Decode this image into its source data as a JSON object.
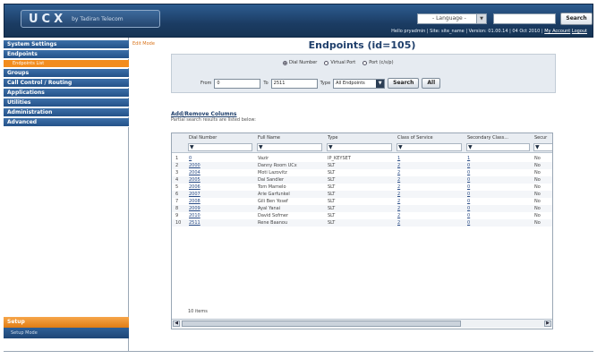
{
  "header": {
    "logo_mark": "UCX",
    "logo_by": "by Tadiran Telecom",
    "language_placeholder": "- Language -",
    "search_button": "Search",
    "status": {
      "greeting": "Hello pryadmin",
      "site": "Site: site_name",
      "version": "Version: 01.00.14",
      "date": "04 Oct 2010",
      "my_account": "My Account",
      "logout": "Logout"
    }
  },
  "sidebar": {
    "items": [
      {
        "label": "System Settings"
      },
      {
        "label": "Endpoints"
      },
      {
        "label": "Groups"
      },
      {
        "label": "Call Control / Routing"
      },
      {
        "label": "Applications"
      },
      {
        "label": "Utilities"
      },
      {
        "label": "Administration"
      },
      {
        "label": "Advanced"
      }
    ],
    "sub_active": "Endpoints List",
    "setup": "Setup",
    "setup_sub": "Setup Mode"
  },
  "main": {
    "breadcrumb": "Edit Mode",
    "title": "Endpoints (id=105)",
    "filter": {
      "radios": [
        "Dial Number",
        "Virtual Port",
        "Port (c/s/p)"
      ],
      "selected_radio": 0,
      "from_label": "From",
      "from_value": "0",
      "to_label": "To",
      "to_value": "2511",
      "type_label": "Type",
      "type_value": "All Endpoints",
      "search_button": "Search",
      "all_button": "All"
    },
    "columns_link": "Add/Remove Columns",
    "results_note": "Partial search results are listed below:",
    "table": {
      "headers": [
        "Dial Number",
        "Full Name",
        "Type",
        "Class of Service",
        "Secondary Class...",
        "Secur"
      ],
      "rows": [
        {
          "num": "1",
          "dial": "0",
          "name": "Vazir",
          "type": "IP_KEYSET",
          "cos": "1",
          "sec": "1",
          "secur": "No"
        },
        {
          "num": "2",
          "dial": "2000",
          "name": "Danny Room UCx",
          "type": "SLT",
          "cos": "2",
          "sec": "0",
          "secur": "No"
        },
        {
          "num": "3",
          "dial": "2004",
          "name": "Moti Lazovitz",
          "type": "SLT",
          "cos": "2",
          "sec": "0",
          "secur": "No"
        },
        {
          "num": "4",
          "dial": "2005",
          "name": "Dai Sandler",
          "type": "SLT",
          "cos": "2",
          "sec": "0",
          "secur": "No"
        },
        {
          "num": "5",
          "dial": "2006",
          "name": "Tom Mamelo",
          "type": "SLT",
          "cos": "2",
          "sec": "0",
          "secur": "No"
        },
        {
          "num": "6",
          "dial": "2007",
          "name": "Arie Garfunkel",
          "type": "SLT",
          "cos": "2",
          "sec": "0",
          "secur": "No"
        },
        {
          "num": "7",
          "dial": "2008",
          "name": "Gili Ben Yosef",
          "type": "SLT",
          "cos": "2",
          "sec": "0",
          "secur": "No"
        },
        {
          "num": "8",
          "dial": "2009",
          "name": "Ayal Yanai",
          "type": "SLT",
          "cos": "2",
          "sec": "0",
          "secur": "No"
        },
        {
          "num": "9",
          "dial": "2010",
          "name": "David Sofmer",
          "type": "SLT",
          "cos": "2",
          "sec": "0",
          "secur": "No"
        },
        {
          "num": "10",
          "dial": "2511",
          "name": "Rene Baanou",
          "type": "SLT",
          "cos": "2",
          "sec": "0",
          "secur": "No"
        }
      ],
      "items_count": "10 items"
    }
  }
}
